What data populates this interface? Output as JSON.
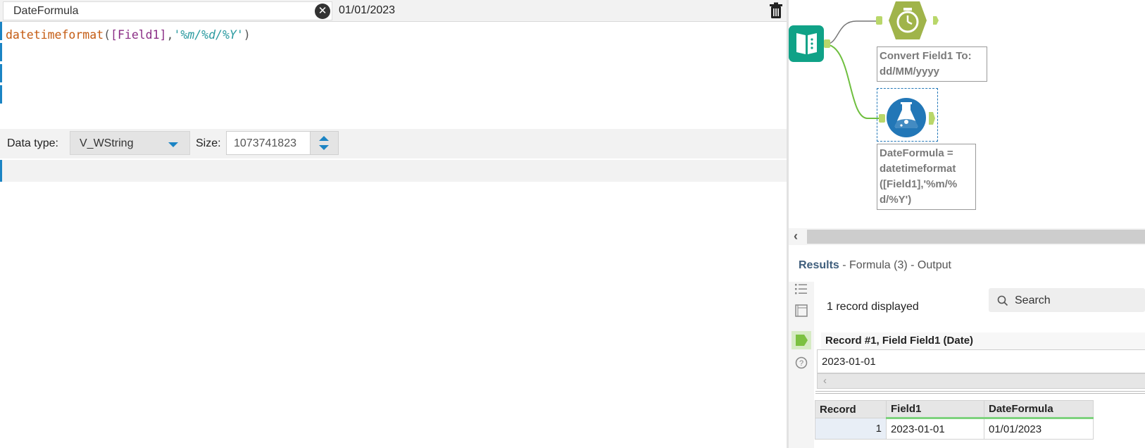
{
  "formula_editor": {
    "field_name": "DateFormula",
    "preview_value": "01/01/2023",
    "expression": {
      "function": "datetimeformat",
      "open_paren": "(",
      "field_ref": "[Field1]",
      "comma": ",",
      "format_string": "'%m/%d/%Y'",
      "close_paren": ")"
    },
    "data_type_label": "Data type:",
    "data_type_value": "V_WString",
    "size_label": "Size:",
    "size_value": "1073741823"
  },
  "canvas": {
    "tools": [
      {
        "name": "input-data",
        "icon": "book-icon",
        "color": "#10a287"
      },
      {
        "name": "datetime",
        "icon": "clock-icon",
        "color": "#a0b44a",
        "label": "Convert Field1 To: dd/MM/yyyy"
      },
      {
        "name": "formula",
        "icon": "flask-icon",
        "color": "#2277b7",
        "label": "DateFormula = datetimeformat ([Field1],'%m/% d/%Y')"
      }
    ],
    "datetime_label_line1": "Convert Field1 To:",
    "datetime_label_line2": "dd/MM/yyyy",
    "formula_label_line1": "DateFormula =",
    "formula_label_line2": "datetimeformat",
    "formula_label_line3": "([Field1],'%m/%",
    "formula_label_line4": "d/%Y')"
  },
  "results": {
    "title": "Results",
    "subtitle": " - Formula (3) - Output",
    "record_count": "1 record displayed",
    "search_placeholder": "Search",
    "detail_header": "Record #1, Field Field1 (Date)",
    "detail_value": "2023-01-01",
    "columns": [
      "Record",
      "Field1",
      "DateFormula"
    ],
    "rows": [
      {
        "record": "1",
        "field1": "2023-01-01",
        "dateformula": "01/01/2023"
      }
    ]
  },
  "colors": {
    "accent_blue": "#1b84c4",
    "connector_green": "#6fbf3f",
    "anchor_green": "#b9d76a"
  }
}
